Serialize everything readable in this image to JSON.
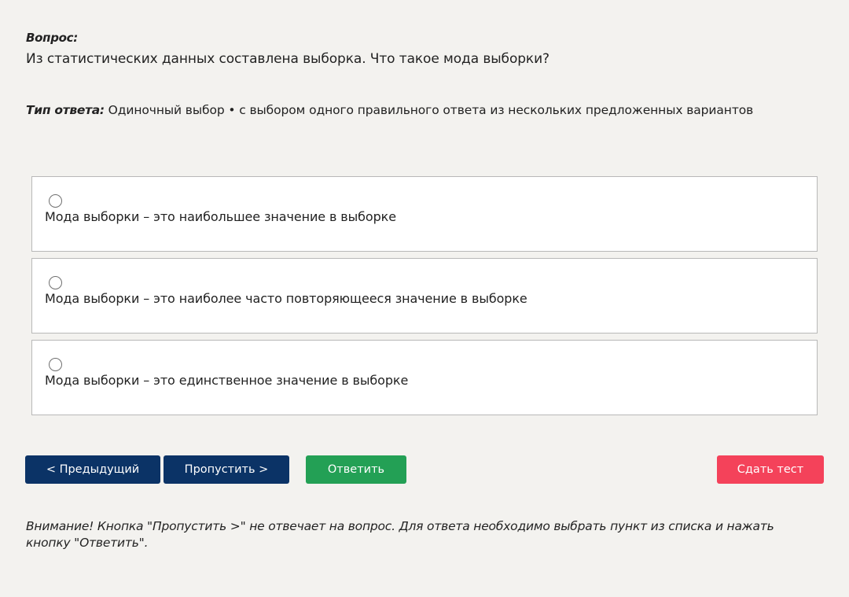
{
  "question": {
    "label": "Вопрос:",
    "text": "Из статистических данных составлена выборка. Что такое мода выборки?"
  },
  "answer_type": {
    "label": "Тип ответа:",
    "value": " Одиночный выбор • с выбором одного правильного ответа из нескольких предложенных вариантов"
  },
  "options": [
    {
      "text": "Мода выборки – это наибольшее значение в выборке",
      "selected": false
    },
    {
      "text": "Мода выборки – это наиболее часто повторяющееся значение в выборке",
      "selected": false
    },
    {
      "text": "Мода выборки – это единственное значение в выборке",
      "selected": false
    }
  ],
  "buttons": {
    "prev": "< Предыдущий",
    "skip": "Пропустить >",
    "answer": "Ответить",
    "submit": "Сдать тест"
  },
  "notice": "Внимание! Кнопка \"Пропустить >\" не отвечает на вопрос. Для ответа необходимо выбрать пункт из списка и нажать кнопку \"Ответить\".",
  "colors": {
    "background": "#f3f2ef",
    "primary_button": "#0b3366",
    "answer_button": "#23a055",
    "submit_button": "#f4425a"
  }
}
